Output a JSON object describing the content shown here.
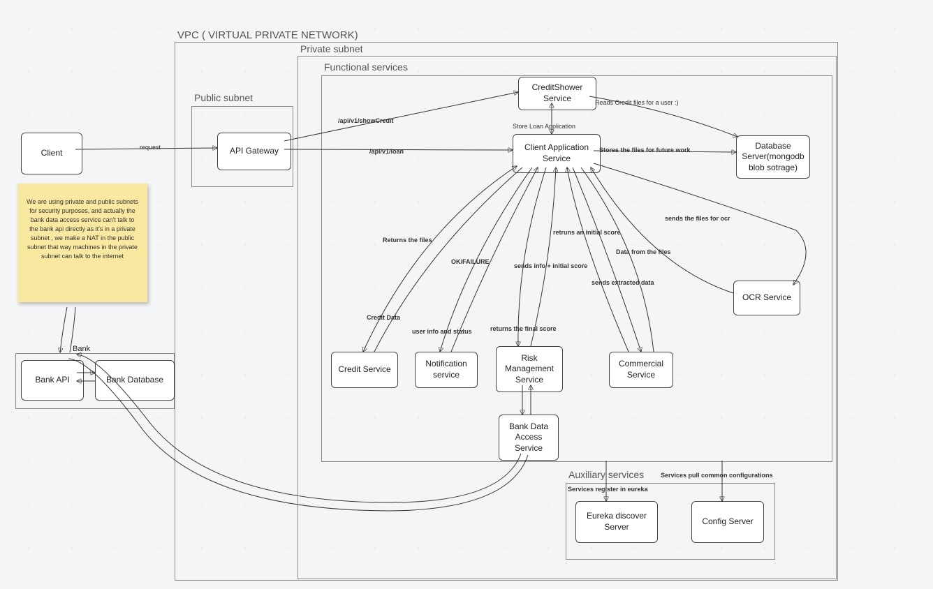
{
  "title_vpc": "VPC ( VIRTUAL PRIVATE NETWORK)",
  "title_private": "Private subnet",
  "title_functional": "Functional services",
  "title_public": "Public subnet",
  "title_aux": "Auxiliary services",
  "title_bank": "Bank",
  "nodes": {
    "client": "Client",
    "api_gw": "API Gateway",
    "credit_shower": "CreditShower Service",
    "client_app": "Client Application Service",
    "db": "Database Server(mongodb blob sotrage)",
    "ocr": "OCR Service",
    "credit": "Credit Service",
    "notif": "Notification service",
    "risk": "Risk Management Service",
    "comm": "Commercial Service",
    "bank_access": "Bank Data Access Service",
    "eureka": "Eureka discover Server",
    "config": "Config Server",
    "bank_api": "Bank API",
    "bank_db": "Bank Database"
  },
  "labels": {
    "request": "request",
    "show_credit": "/api/v1/showCredit",
    "loan": "/api/v1/loan",
    "reads": "Reads Credit files for a user :)",
    "store_loan": "Store Loan Application",
    "stores": "Stores the files for future work",
    "returns_files": "Returns the files",
    "ok_fail": "OK/FAILURE",
    "sends_info": "sends info + initial score",
    "initial_score": "retruns an initial score",
    "data_files": "Data from the files",
    "sends_ocr": "sends the files for ocr",
    "sends_extracted": "sends extracted data",
    "credit_data": "Credit Data",
    "user_info": "user info and status",
    "final_score": "returns the final score",
    "reg_eureka": "Services register in eureka",
    "pull_cfg": "Services pull common configurations"
  },
  "sticky": "We are using private and public subnets for security purposes, and actually the bank data access service can't talk to the bank api directly as it's in a private subnet , we make a NAT in the public subnet that way machines in the private subnet can talk to the internet"
}
